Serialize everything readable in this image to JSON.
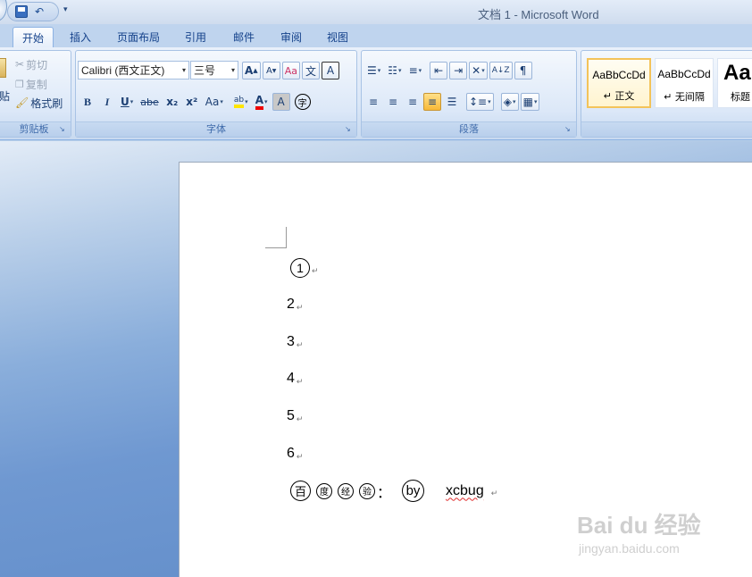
{
  "window": {
    "title": "文档 1 - Microsoft Word"
  },
  "qat": {
    "dropdown": "▾"
  },
  "tabs": [
    {
      "label": "开始",
      "active": true
    },
    {
      "label": "插入"
    },
    {
      "label": "页面布局"
    },
    {
      "label": "引用"
    },
    {
      "label": "邮件"
    },
    {
      "label": "审阅"
    },
    {
      "label": "视图"
    }
  ],
  "clipboard": {
    "paste": "贴",
    "cut": "剪切",
    "copy": "复制",
    "format_painter": "格式刷",
    "group_label": "剪贴板"
  },
  "font": {
    "font_name": "Calibri (西文正文)",
    "font_size": "三号",
    "grow": "A",
    "shrink": "A",
    "phonetic": "文",
    "border_char": "A",
    "bold": "B",
    "italic": "I",
    "underline": "U",
    "strike": "abe",
    "subscript": "x₂",
    "superscript": "x²",
    "change_case": "Aa",
    "highlight": "ab",
    "font_color": "A",
    "char_shading": "A",
    "enclose": "字",
    "group_label": "字体"
  },
  "paragraph": {
    "group_label": "段落",
    "sort": "A↓Z"
  },
  "styles": [
    {
      "sample": "AaBbCcDd",
      "name": "↵ 正文"
    },
    {
      "sample": "AaBbCcDd",
      "name": "↵ 无间隔"
    },
    {
      "sample": "AaB",
      "name": "标题"
    }
  ],
  "document": {
    "lines": [
      "1",
      "2",
      "3",
      "4",
      "5",
      "6"
    ],
    "last_line": {
      "c1": "百",
      "c2": "度",
      "c3": "经",
      "c4": "验",
      "colon": "：",
      "by": "by",
      "author": "xcbug"
    },
    "pilcrow": "↵"
  },
  "watermark": {
    "logo": "Bai du 经验",
    "url": "jingyan.baidu.com"
  },
  "colors": {
    "ribbon_text": "#15428b",
    "accent_style": "#f3c35a",
    "workspace": "#6f98d1"
  }
}
